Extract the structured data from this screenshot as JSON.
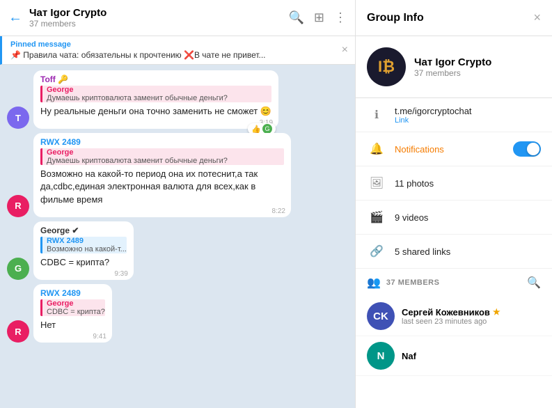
{
  "header": {
    "title": "Чат Igor Crypto",
    "members": "37 members",
    "back": "←",
    "search_icon": "🔍",
    "layout_icon": "⊞",
    "more_icon": "⋮"
  },
  "pinned": {
    "label": "Pinned message",
    "icon": "📌",
    "text": "Правила чата: обязательны к прочтению ❌В чате не привет..."
  },
  "messages": [
    {
      "id": "msg1",
      "sender": "Toff",
      "sender_color": "#9c27b0",
      "avatar_letter": "T",
      "avatar_color": "#7B68EE",
      "quote_name": "George",
      "quote_color": "#e91e63",
      "quote_text": "Думаешь криптовалюта заменит обычные деньги?",
      "text": "Ну реальные деньги она точно заменить не сможет 😊",
      "time": "3:19",
      "reaction": "👍",
      "reaction_count": "G",
      "has_emoji": true
    },
    {
      "id": "msg2",
      "sender": "RWX 2489",
      "sender_color": "#2196F3",
      "avatar_letter": "R",
      "avatar_color": "#e91e63",
      "quote_name": "George",
      "quote_color": "#e91e63",
      "quote_text": "Думаешь криптовалюта заменит обычные деньги?",
      "text": "Возможно на какой-то период она их потеснит,а так да,cdbc,единая электронная валюта для всех,как в фильме время",
      "time": "8:22"
    },
    {
      "id": "msg3",
      "sender": "George",
      "sender_color": "#000",
      "avatar_letter": "G",
      "avatar_color": "#4CAF50",
      "quote_name": "RWX 2489",
      "quote_color": "#2196F3",
      "quote_text": "Возможно на какой-то...",
      "text": "CDBC = крипта?",
      "time": "9:39",
      "verified": true
    },
    {
      "id": "msg4",
      "sender": "RWX 2489",
      "sender_color": "#2196F3",
      "avatar_letter": "R",
      "avatar_color": "#e91e63",
      "quote_name": "George",
      "quote_color": "#e91e63",
      "quote_text": "CDBC = крипта?",
      "text": "Нет",
      "time": "9:41"
    }
  ],
  "right_panel": {
    "title": "Group Info",
    "close": "×",
    "group_name": "Чат Igor Crypto",
    "group_members": "37 members",
    "link": "t.me/igorcryptochat",
    "link_label": "Link",
    "notifications_label": "Notifications",
    "photos": "11 photos",
    "videos": "9 videos",
    "shared_links": "5 shared links",
    "members_label": "37 MEMBERS",
    "members": [
      {
        "name": "Сергей Кожевников",
        "status": "last seen 23 minutes ago",
        "initials": "CK",
        "color": "#3f51b5",
        "starred": true
      },
      {
        "name": "Naf",
        "status": "",
        "initials": "N",
        "color": "#009688",
        "starred": false
      }
    ]
  }
}
